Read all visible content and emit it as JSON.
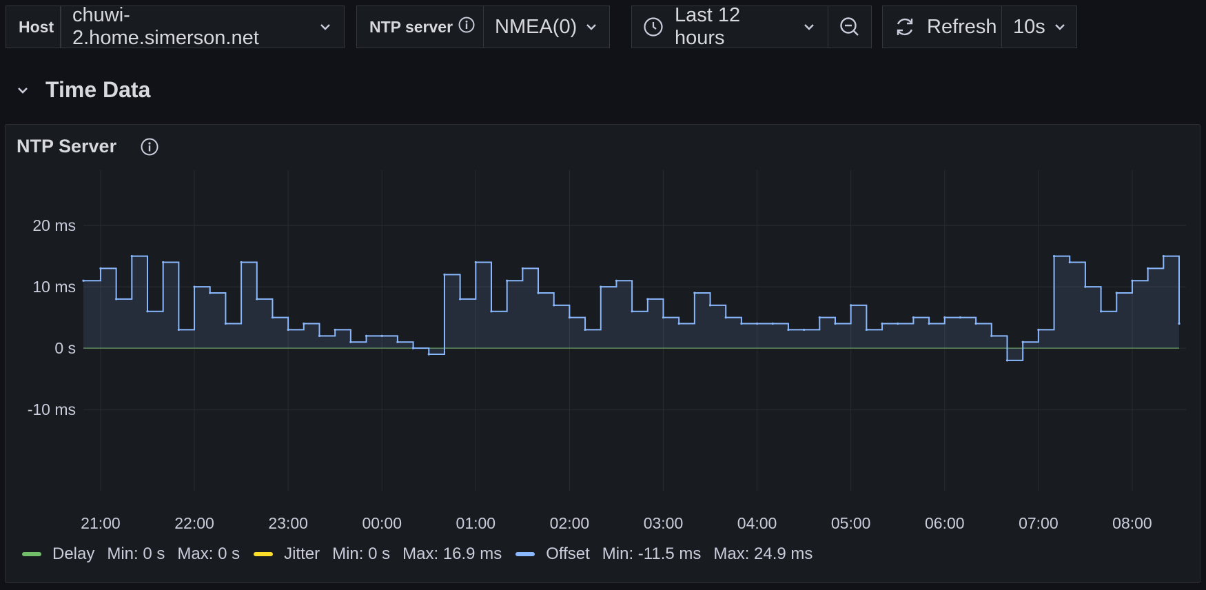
{
  "toolbar": {
    "host_label": "Host",
    "host_value": "chuwi-2.home.simerson.net",
    "ntp_label": "NTP server",
    "ntp_value": "NMEA(0)",
    "time_range": "Last 12 hours",
    "refresh_label": "Refresh",
    "refresh_interval": "10s"
  },
  "row": {
    "title": "Time Data"
  },
  "panel": {
    "title": "NTP Server"
  },
  "legend": [
    {
      "name": "Delay",
      "min": "Min: 0 s",
      "max": "Max: 0 s",
      "color": "#73bf69"
    },
    {
      "name": "Jitter",
      "min": "Min: 0 s",
      "max": "Max: 16.9 ms",
      "color": "#fade2a"
    },
    {
      "name": "Offset",
      "min": "Min: -11.5 ms",
      "max": "Max: 24.9 ms",
      "color": "#8ab8ff"
    }
  ],
  "chart_data": {
    "type": "line",
    "x_start": "20:49",
    "x_end": "08:30",
    "x_ticks": [
      "21:00",
      "22:00",
      "23:00",
      "00:00",
      "01:00",
      "02:00",
      "03:00",
      "04:00",
      "05:00",
      "06:00",
      "07:00",
      "08:00"
    ],
    "y_ticks": [
      "-10 ms",
      "0 s",
      "10 ms",
      "20 ms"
    ],
    "y_tick_values": [
      -10,
      0,
      10,
      20
    ],
    "ylim": [
      -16.5,
      29
    ],
    "y_unit": "ms",
    "series": [
      {
        "name": "Offset",
        "color": "#8ab8ff",
        "fill": true,
        "x": [
          "20:49",
          "21:00",
          "21:10",
          "21:20",
          "21:30",
          "21:40",
          "21:50",
          "22:00",
          "22:10",
          "22:20",
          "22:30",
          "22:40",
          "22:50",
          "23:00",
          "23:10",
          "23:20",
          "23:30",
          "23:40",
          "23:50",
          "00:00",
          "00:10",
          "00:20",
          "00:30",
          "00:40",
          "00:50",
          "01:00",
          "01:10",
          "01:20",
          "01:30",
          "01:40",
          "01:50",
          "02:00",
          "02:10",
          "02:20",
          "02:30",
          "02:40",
          "02:50",
          "03:00",
          "03:10",
          "03:20",
          "03:30",
          "03:40",
          "03:50",
          "04:00",
          "04:10",
          "04:20",
          "04:30",
          "04:40",
          "04:50",
          "05:00",
          "05:10",
          "05:20",
          "05:30",
          "05:40",
          "05:50",
          "06:00",
          "06:10",
          "06:20",
          "06:30",
          "06:40",
          "06:50",
          "07:00",
          "07:10",
          "07:20",
          "07:30",
          "07:40",
          "07:50",
          "08:00",
          "08:10",
          "08:20",
          "08:30"
        ],
        "values": [
          11,
          13,
          8,
          15,
          6,
          14,
          3,
          10,
          9,
          4,
          14,
          8,
          5,
          3,
          4,
          2,
          3,
          1,
          2,
          2,
          1,
          0,
          -1,
          12,
          8,
          14,
          6,
          11,
          13,
          9,
          7,
          5,
          3,
          10,
          11,
          6,
          8,
          5,
          4,
          9,
          7,
          5,
          4,
          4,
          4,
          3,
          3,
          5,
          4,
          7,
          3,
          4,
          4,
          5,
          4,
          5,
          5,
          4,
          2,
          -2,
          1,
          3,
          15,
          14,
          10,
          6,
          9,
          11,
          13,
          15,
          4
        ]
      }
    ]
  }
}
